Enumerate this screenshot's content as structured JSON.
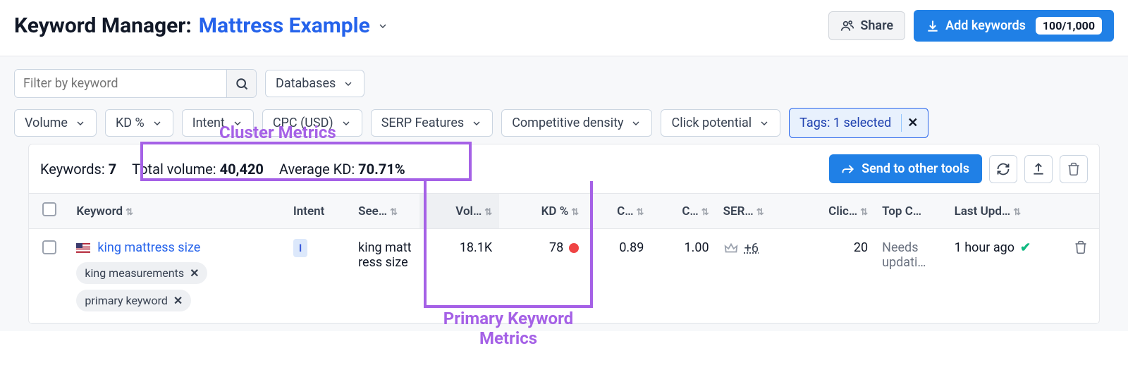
{
  "header": {
    "title_prefix": "Keyword Manager:",
    "list_name": "Mattress Example",
    "share_label": "Share",
    "add_label": "Add keywords",
    "add_badge": "100/1,000"
  },
  "filters": {
    "search_placeholder": "Filter by keyword",
    "databases": "Databases",
    "volume": "Volume",
    "kd": "KD %",
    "intent": "Intent",
    "cpc": "CPC (USD)",
    "serp": "SERP Features",
    "density": "Competitive density",
    "click": "Click potential",
    "tags_selected": "Tags: 1 selected"
  },
  "summary": {
    "keywords_label": "Keywords:",
    "keywords_count": "7",
    "total_volume_label": "Total volume:",
    "total_volume": "40,420",
    "avg_kd_label": "Average KD:",
    "avg_kd": "70.71%",
    "send_label": "Send to other tools"
  },
  "columns": {
    "keyword": "Keyword",
    "intent": "Intent",
    "seed": "See…",
    "vol": "Vol…",
    "kd": "KD %",
    "cpc": "C…",
    "density": "C…",
    "serp": "SER…",
    "click": "Clic…",
    "topc": "Top C…",
    "updated": "Last Upd…"
  },
  "row": {
    "keyword": "king mattress size",
    "tags": [
      "king measurements",
      "primary keyword"
    ],
    "intent": "I",
    "seed": "king mattress size",
    "vol": "18.1K",
    "kd": "78",
    "cpc": "0.89",
    "density": "1.00",
    "serp_more": "+6",
    "click": "20",
    "topc": "Needs updati…",
    "updated": "1 hour ago"
  },
  "annotations": {
    "cluster": "Cluster Metrics",
    "primary": "Primary Keyword Metrics"
  }
}
